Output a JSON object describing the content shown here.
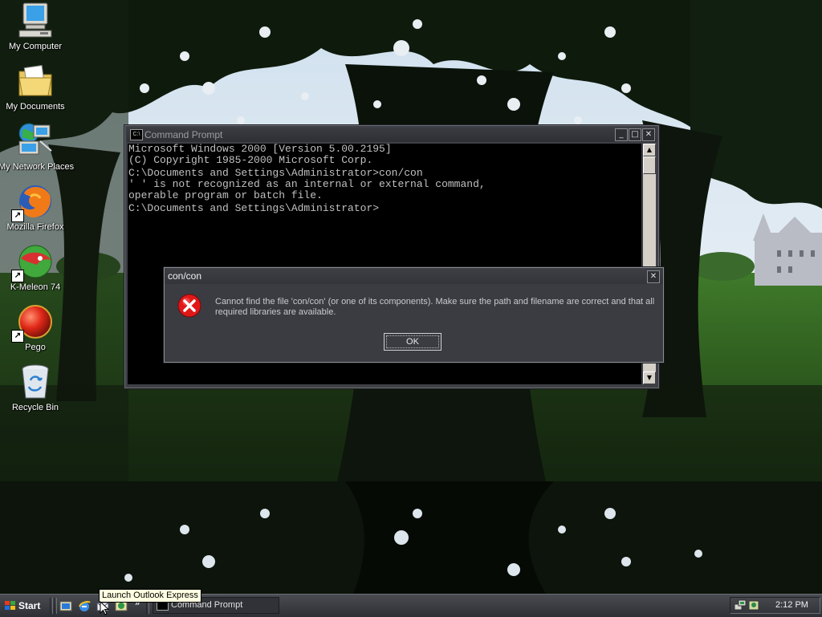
{
  "desktop": {
    "icons": [
      {
        "label": "My Computer"
      },
      {
        "label": "My Documents"
      },
      {
        "label": "My Network Places"
      },
      {
        "label": "Mozilla Firefox"
      },
      {
        "label": "K-Meleon 74"
      },
      {
        "label": "Pego"
      },
      {
        "label": "Recycle Bin"
      }
    ]
  },
  "cmd_window": {
    "title": "Command Prompt",
    "console_lines": [
      "Microsoft Windows 2000 [Version 5.00.2195]",
      "(C) Copyright 1985-2000 Microsoft Corp.",
      "",
      "C:\\Documents and Settings\\Administrator>con/con",
      "' ' is not recognized as an internal or external command,",
      "operable program or batch file.",
      "",
      "C:\\Documents and Settings\\Administrator>"
    ]
  },
  "error_dialog": {
    "title": "con/con",
    "message": "Cannot find the file 'con/con' (or one of its components). Make sure the path and filename are correct and that all required libraries are available.",
    "ok_label": "OK"
  },
  "taskbar": {
    "start_label": "Start",
    "task_cmd_label": "Command Prompt",
    "clock": "2:12 PM",
    "tooltip": "Launch Outlook Express",
    "quick_launch": [
      "show-desktop-icon",
      "internet-explorer-icon",
      "outlook-express-icon",
      "media-player-icon"
    ]
  },
  "colors": {
    "console_bg": "#000000",
    "console_text": "#c0c0c0",
    "window_frame": "#3e4046",
    "error_icon": "#e01818",
    "tooltip_bg": "#ffffe1"
  }
}
